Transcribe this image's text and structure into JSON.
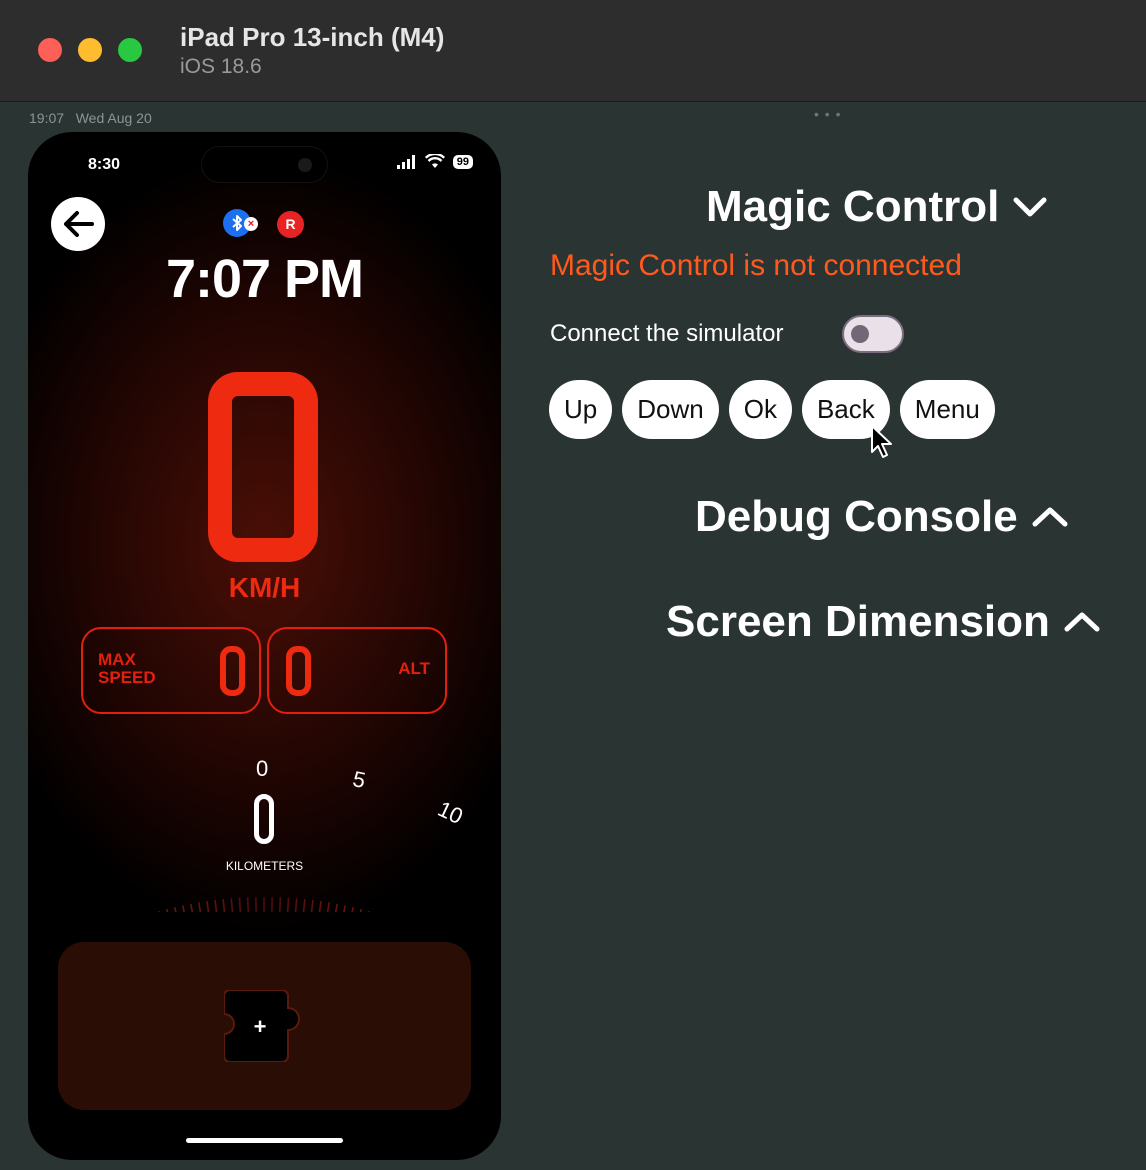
{
  "window": {
    "title": "iPad Pro 13-inch (M4)",
    "subtitle": "iOS 18.6"
  },
  "ipad_status": {
    "time": "19:07",
    "date": "Wed Aug 20"
  },
  "phone": {
    "status_time": "8:30",
    "battery": "99",
    "r_badge": "R",
    "clock": "7:07 PM",
    "speed_unit": "KM/H",
    "max_speed_label_1": "MAX",
    "max_speed_label_2": "SPEED",
    "alt_label": "ALT",
    "speed_value": 0,
    "max_speed_value": 0,
    "alt_value": 0,
    "dial_numbers": [
      "0",
      "5",
      "10"
    ],
    "distance_value": 0,
    "distance_label": "KILOMETERS",
    "widget_add": "+"
  },
  "panel": {
    "magic_title": "Magic Control",
    "magic_warning": "Magic Control is not connected",
    "connect_label": "Connect the simulator",
    "connect_on": false,
    "buttons": [
      "Up",
      "Down",
      "Ok",
      "Back",
      "Menu"
    ],
    "debug_title": "Debug Console",
    "screen_title": "Screen Dimension"
  },
  "colors": {
    "accent_red": "#ee2a10",
    "warning_orange": "#ff5a1c",
    "background": "#2a3533"
  }
}
